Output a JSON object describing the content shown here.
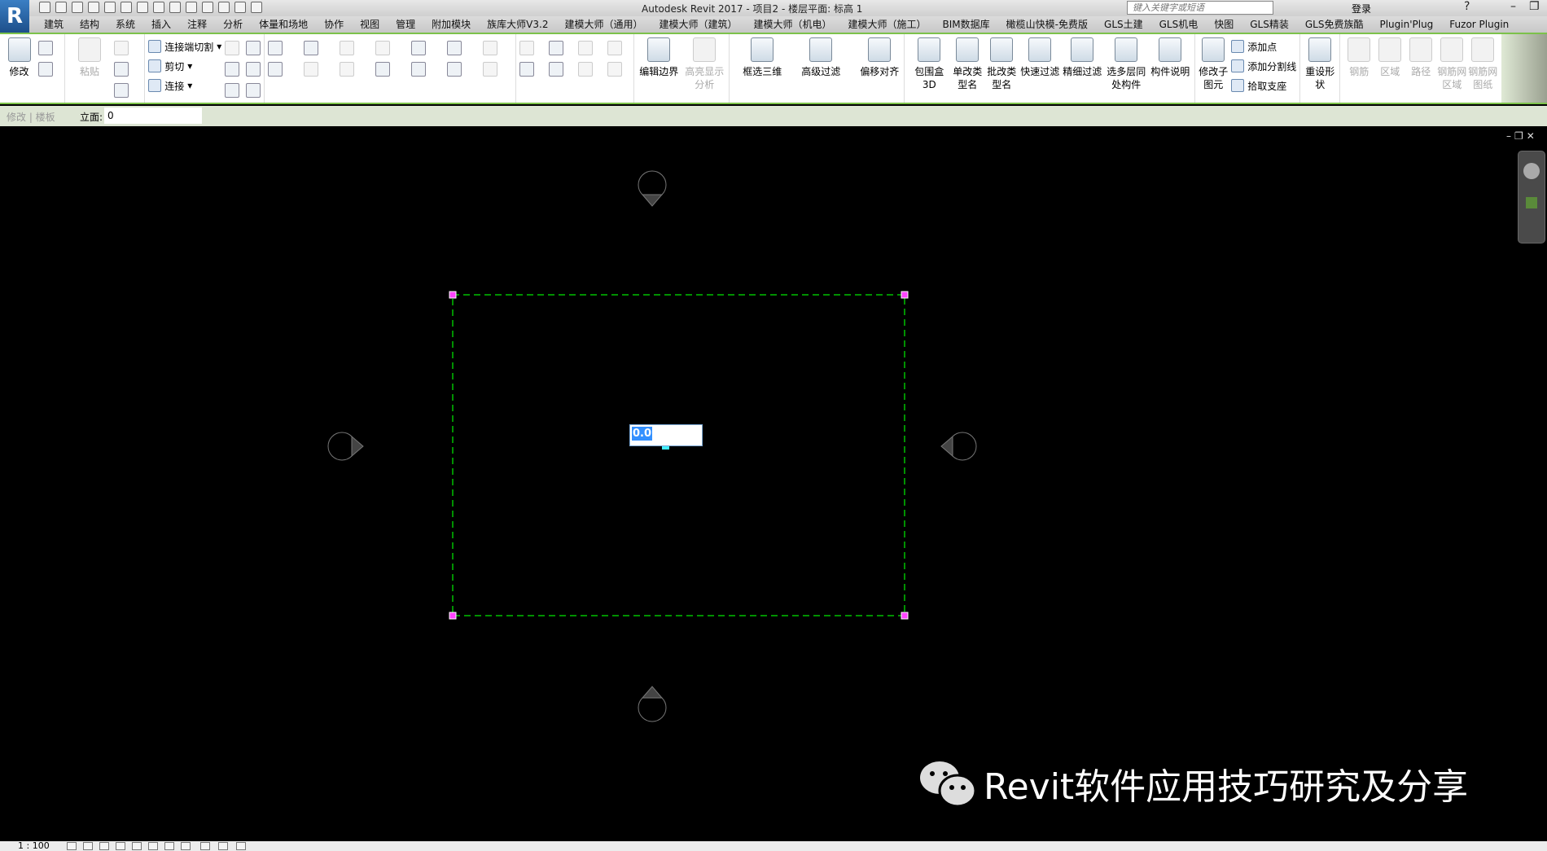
{
  "app": {
    "logo": "R",
    "title": "Autodesk Revit 2017 -    项目2 - 楼层平面: 标高 1",
    "search_placeholder": "键入关键字或短语",
    "login": "登录"
  },
  "tabs": [
    "建筑",
    "结构",
    "系统",
    "插入",
    "注释",
    "分析",
    "体量和场地",
    "协作",
    "视图",
    "管理",
    "附加模块",
    "族库大师V3.2",
    "建模大师（通用）",
    "建模大师（建筑）",
    "建模大师（机电）",
    "建模大师（施工）",
    "BIM数据库",
    "橄榄山快模-免费版",
    "GLS土建",
    "GLS机电",
    "快图",
    "GLS精装",
    "GLS免费族酷",
    "Plugin'Plug",
    "Fuzor Plugin"
  ],
  "ribbon": {
    "modify": "修改",
    "paste": "粘贴",
    "join_cut": "连接端切割",
    "cut": "剪切",
    "join": "连接",
    "edit_boundary": "编辑边界",
    "highlight": "高亮显示分析",
    "box3d": "框选三维",
    "adv_filter": "高级过滤",
    "offset_align": "偏移对齐",
    "bbox3d": "包围盒3D",
    "rename_single": "单改类型名",
    "rename_batch": "批改类型名",
    "quick_filter": "快速过滤",
    "fine_filter": "精细过滤",
    "multi_level": "选多层同处构件",
    "comp_desc": "构件说明",
    "modify_sub": "修改子图元",
    "add_point": "添加点",
    "add_split": "添加分割线",
    "pick_support": "拾取支座",
    "reset_shape": "重设形状",
    "rebar": "钢筋",
    "area": "区域",
    "path": "路径",
    "fabric_area": "钢筋网区域",
    "fabric_sheet": "钢筋网图纸"
  },
  "options_bar": {
    "context": "修改 | 楼板",
    "elevation_label": "立面:",
    "elevation_value": "0"
  },
  "canvas": {
    "dimension_value": "0.0",
    "boundary_color": "#00c000",
    "grip_color": "#ff44ff"
  },
  "status": {
    "scale": "1 : 100"
  },
  "watermark": "Revit软件应用技巧研究及分享"
}
